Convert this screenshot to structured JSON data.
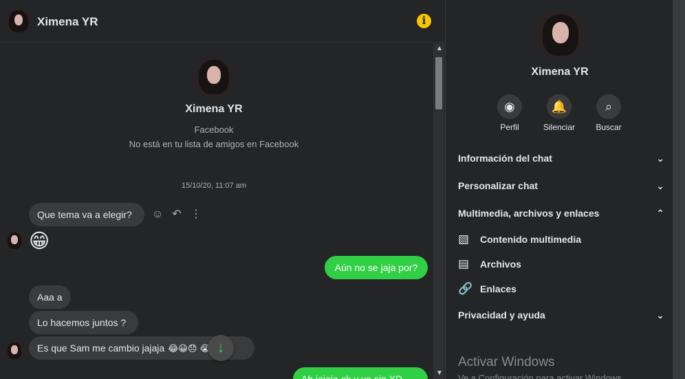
{
  "header": {
    "name": "Ximena YR",
    "info_icon": "info-icon"
  },
  "profile": {
    "name": "Ximena YR",
    "source": "Facebook",
    "note": "No está en tu lista de amigos en Facebook"
  },
  "conversation": {
    "timestamp": "15/10/20, 11:07 am",
    "messages": [
      {
        "direction": "incoming",
        "text": "Que tema va a elegir?"
      },
      {
        "direction": "incoming",
        "text": "😁"
      },
      {
        "direction": "outgoing",
        "text": "Aún no se jaja por?"
      },
      {
        "direction": "incoming",
        "text": "Aaa a"
      },
      {
        "direction": "incoming",
        "text": "Lo hacemos juntos ?"
      },
      {
        "direction": "incoming",
        "text": "Es que Sam me cambio jajaja",
        "emojis": "😂😀😞 😭"
      },
      {
        "direction": "outgoing",
        "text": "Ah jajaja ok y yo sin XD"
      }
    ]
  },
  "actions": {
    "react_icon": "smile-react-icon",
    "reply_icon": "reply-icon",
    "more_icon": "more-options-icon",
    "scroll_down_icon": "arrow-down-icon"
  },
  "sidebar": {
    "name": "Ximena YR",
    "buttons": [
      {
        "label": "Perfil",
        "icon": "profile-icon"
      },
      {
        "label": "Silenciar",
        "icon": "bell-icon"
      },
      {
        "label": "Buscar",
        "icon": "search-icon"
      }
    ],
    "sections": [
      {
        "label": "Información del chat",
        "icon": "chevron-down-icon"
      },
      {
        "label": "Personalizar chat",
        "icon": "chevron-down-icon"
      },
      {
        "label": "Multimedia, archivos y enlaces",
        "icon": "chevron-up-icon"
      },
      {
        "label": "Privacidad y ayuda",
        "icon": "chevron-down-icon"
      }
    ],
    "media_items": [
      {
        "label": "Contenido multimedia",
        "icon": "image-icon"
      },
      {
        "label": "Archivos",
        "icon": "file-icon"
      },
      {
        "label": "Enlaces",
        "icon": "link-icon"
      }
    ]
  },
  "watermark": {
    "title": "Activar Windows",
    "subtitle": "Ve a Configuración para activar Windows."
  },
  "colors": {
    "background": "#242526",
    "incoming_bubble": "#3a3b3c",
    "outgoing_bubble": "#31cf45",
    "accent": "#f7c600"
  }
}
